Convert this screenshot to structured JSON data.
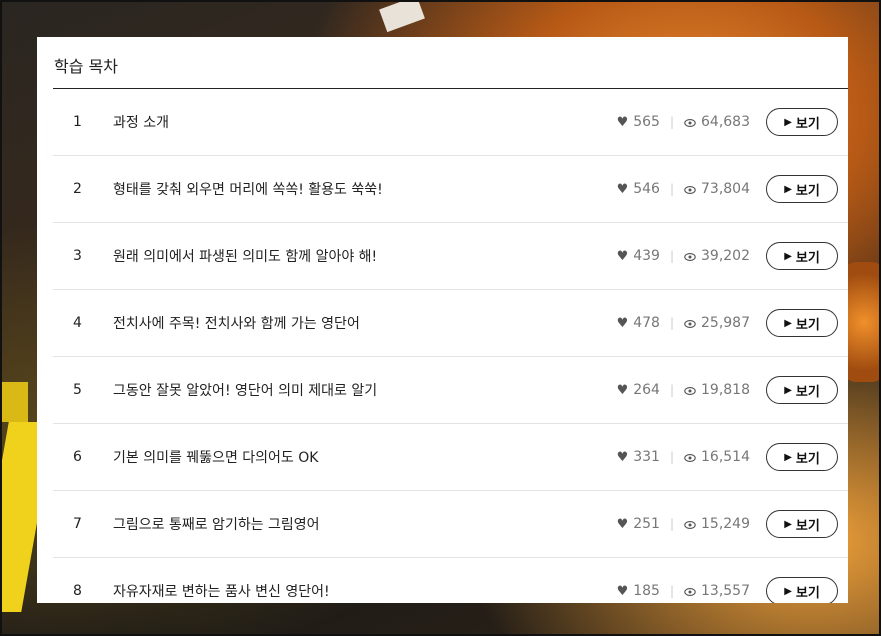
{
  "panel": {
    "title": "학습 목차"
  },
  "lessons": [
    {
      "num": "1",
      "title": "과정 소개",
      "likes": "565",
      "views": "64,683",
      "button": "보기"
    },
    {
      "num": "2",
      "title": "형태를 갖춰 외우면 머리에 쏙쏙! 활용도 쑥쑥!",
      "likes": "546",
      "views": "73,804",
      "button": "보기"
    },
    {
      "num": "3",
      "title": "원래 의미에서 파생된 의미도 함께 알아야 해!",
      "likes": "439",
      "views": "39,202",
      "button": "보기"
    },
    {
      "num": "4",
      "title": "전치사에 주목! 전치사와 함께 가는 영단어",
      "likes": "478",
      "views": "25,987",
      "button": "보기"
    },
    {
      "num": "5",
      "title": "그동안 잘못 알았어! 영단어 의미 제대로 알기",
      "likes": "264",
      "views": "19,818",
      "button": "보기"
    },
    {
      "num": "6",
      "title": "기본 의미를 꿰뚫으면 다의어도 OK",
      "likes": "331",
      "views": "16,514",
      "button": "보기"
    },
    {
      "num": "7",
      "title": "그림으로 통째로 암기하는 그림영어",
      "likes": "251",
      "views": "15,249",
      "button": "보기"
    },
    {
      "num": "8",
      "title": "자유자재로 변하는 품사 변신 영단어!",
      "likes": "185",
      "views": "13,557",
      "button": "보기"
    }
  ],
  "icons": {
    "like": "heart-icon",
    "views": "eye-icon",
    "play": "play-icon"
  }
}
